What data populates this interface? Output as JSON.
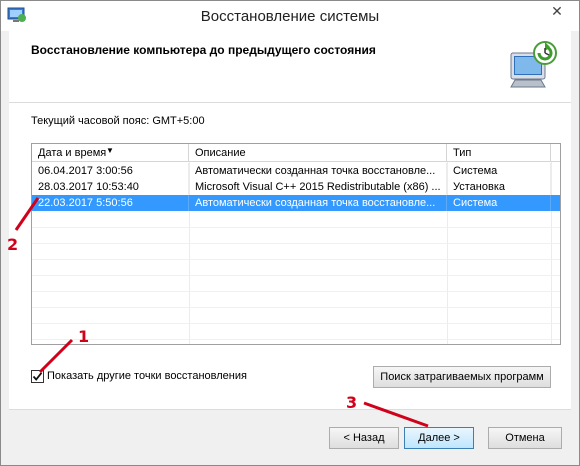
{
  "window": {
    "title": "Восстановление системы",
    "close_glyph": "✕"
  },
  "header": {
    "title": "Восстановление компьютера до предыдущего состояния",
    "icon": "system-restore-icon"
  },
  "timezone_text": "Текущий часовой пояс: GMT+5:00",
  "table": {
    "columns": [
      "Дата и время",
      "Описание",
      "Тип"
    ],
    "sort_indicator": "▼",
    "rows": [
      {
        "date": "06.04.2017 3:00:56",
        "description": "Автоматически созданная точка восстановле...",
        "type": "Система",
        "selected": false
      },
      {
        "date": "28.03.2017 10:53:40",
        "description": "Microsoft Visual C++ 2015 Redistributable (x86) ...",
        "type": "Установка",
        "selected": false
      },
      {
        "date": "22.03.2017 5:50:56",
        "description": "Автоматически созданная точка восстановле...",
        "type": "Система",
        "selected": true
      }
    ]
  },
  "show_more": {
    "label": "Показать другие точки восстановления",
    "checked": true
  },
  "buttons": {
    "search": "Поиск затрагиваемых программ",
    "back": "< Назад",
    "next": "Далее >",
    "cancel": "Отмена"
  },
  "annotations": {
    "one": "1",
    "two": "2",
    "three": "3",
    "color": "#d0021b"
  },
  "colors": {
    "selection": "#3399ff",
    "primary_border": "#3c7fb1"
  }
}
